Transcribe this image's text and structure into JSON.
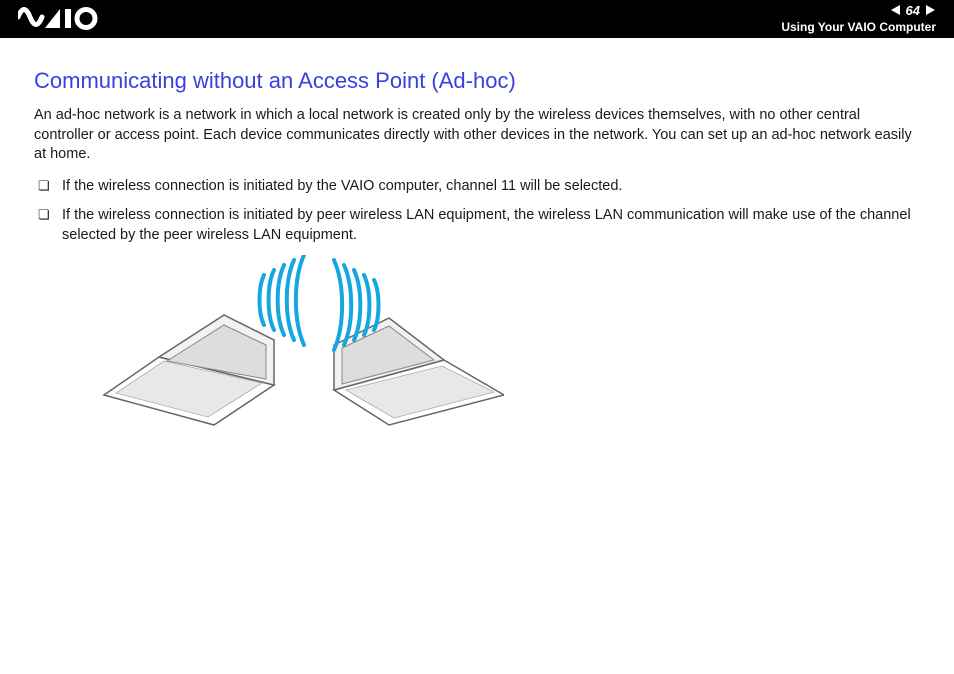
{
  "header": {
    "logo_text": "VAIO",
    "page_number": "64",
    "section_title": "Using Your VAIO Computer"
  },
  "content": {
    "heading": "Communicating without an Access Point (Ad-hoc)",
    "intro": "An ad-hoc network is a network in which a local network is created only by the wireless devices themselves, with no other central controller or access point. Each device communicates directly with other devices in the network. You can set up an ad-hoc network easily at home.",
    "bullets": [
      "If the wireless connection is initiated by the VAIO computer, channel 11 will be selected.",
      "If the wireless connection is initiated by peer wireless LAN equipment, the wireless LAN communication will make use of the channel selected by the peer wireless LAN equipment."
    ]
  },
  "figure": {
    "description": "Two laptops communicating wirelessly via ad-hoc signal"
  }
}
